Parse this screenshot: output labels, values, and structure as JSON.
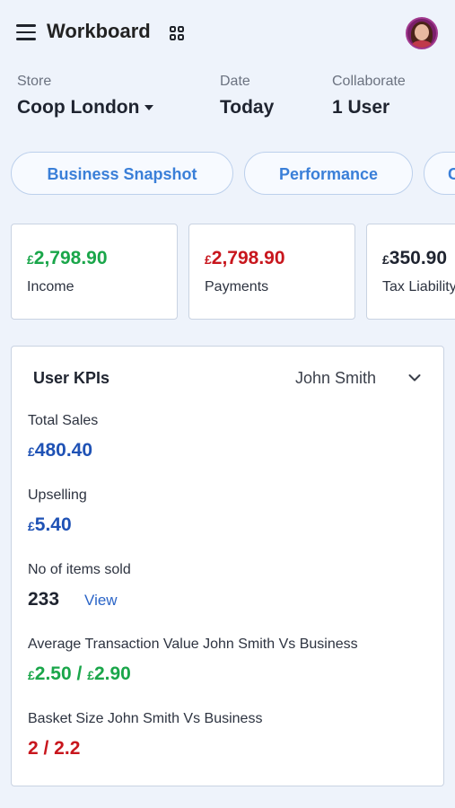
{
  "header": {
    "title": "Workboard"
  },
  "store": {
    "label": "Store",
    "value": "Coop London"
  },
  "date": {
    "label": "Date",
    "value": "Today"
  },
  "collaborate": {
    "label": "Collaborate",
    "value": "1 User"
  },
  "tabs": [
    {
      "label": "Business Snapshot"
    },
    {
      "label": "Performance"
    },
    {
      "label": "C"
    }
  ],
  "summary_cards": [
    {
      "currency": "£",
      "amount": "2,798.90",
      "label": "Income",
      "color": "#1aa64a"
    },
    {
      "currency": "£",
      "amount": "2,798.90",
      "label": "Payments",
      "color": "#c8161d"
    },
    {
      "currency": "£",
      "amount": "350.90",
      "label": "Tax Liability",
      "color": "#1f2430"
    }
  ],
  "kpi": {
    "title": "User KPIs",
    "selected_user": "John Smith",
    "metrics": [
      {
        "label": "Total Sales",
        "currency": "£",
        "value": "480.40"
      },
      {
        "label": "Upselling",
        "currency": "£",
        "value": "5.40"
      },
      {
        "label": "No of items sold",
        "value": "233",
        "link": "View"
      },
      {
        "label": "Average Transaction Value John Smith Vs Business",
        "currency1": "£",
        "value1": "2.50",
        "sep": " / ",
        "currency2": "£",
        "value2": "2.90"
      },
      {
        "label": "Basket Size John Smith Vs Business",
        "value": "2 / 2.2"
      }
    ]
  },
  "colors": {
    "accent": "#3a7fd8",
    "positive": "#1aa64a",
    "negative": "#c8161d",
    "value_blue": "#1f52b5"
  }
}
